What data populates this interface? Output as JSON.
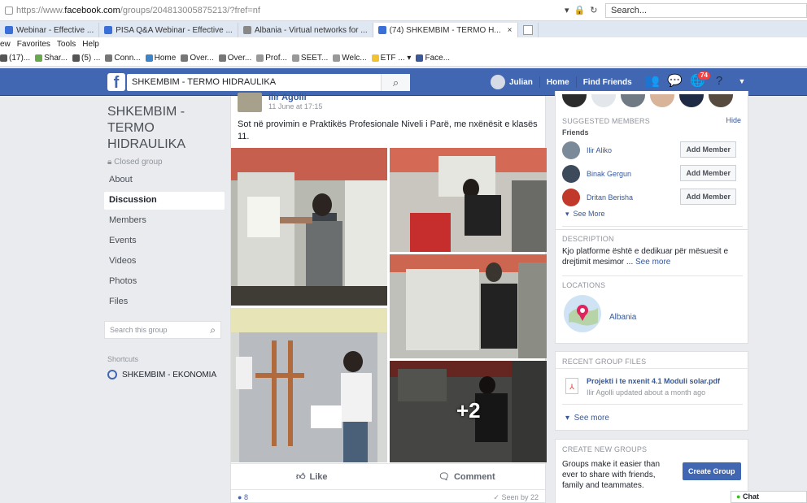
{
  "browser": {
    "url_prefix": "https://www.",
    "url_domain": "facebook.com",
    "url_path": "/groups/204813005875213/?fref=nf",
    "search_placeholder": "Search...",
    "tabs": [
      {
        "label": "Webinar - Effective ...",
        "color": "#3a6fd8"
      },
      {
        "label": "PISA Q&A Webinar - Effective ...",
        "color": "#3a6fd8"
      },
      {
        "label": "Albania - Virtual networks for ...",
        "color": "#888888"
      },
      {
        "label": "(74) SHKEMBIM - TERMO H...",
        "color": "#3a6fd8",
        "active": true
      }
    ],
    "menu": [
      "ew",
      "Favorites",
      "Tools",
      "Help"
    ],
    "favorites": [
      {
        "label": "(17)...",
        "color": "#555555"
      },
      {
        "label": "Shar...",
        "color": "#6aa84f"
      },
      {
        "label": "(5) ...",
        "color": "#555555"
      },
      {
        "label": "Conn...",
        "color": "#777777"
      },
      {
        "label": "Home",
        "color": "#3d85c6"
      },
      {
        "label": "Over...",
        "color": "#777777"
      },
      {
        "label": "Over...",
        "color": "#777777"
      },
      {
        "label": "Prof...",
        "color": "#999999"
      },
      {
        "label": "SEET...",
        "color": "#999999"
      },
      {
        "label": "Welc...",
        "color": "#999999"
      },
      {
        "label": "ETF ... ▾",
        "color": "#f1c232"
      },
      {
        "label": "Face...",
        "color": "#3b5998"
      }
    ]
  },
  "fb": {
    "logo": "f",
    "search_value": "SHKEMBIM - TERMO HIDRAULIKA",
    "user_name": "Julian",
    "home_label": "Home",
    "find_friends_label": "Find Friends",
    "notif_count": "74"
  },
  "left": {
    "group_name": "SHKEMBIM - TERMO HIDRAULIKA",
    "closed_label": "Closed group",
    "nav": [
      "About",
      "Discussion",
      "Members",
      "Events",
      "Videos",
      "Photos",
      "Files"
    ],
    "active_nav": "Discussion",
    "search_placeholder": "Search this group",
    "shortcuts_label": "Shortcuts",
    "shortcut_item": "SHKEMBIM - EKONOMIA"
  },
  "post": {
    "author": "Ilir Agolli",
    "time": "11 June at 17:15",
    "text": "Sot në provimin e Praktikës Profesionale Niveli i Parë, me nxënësit e klasës 11.",
    "more_photos": "+2",
    "like_label": "Like",
    "comment_label": "Comment",
    "reaction_count": "8",
    "seen_by": "✓ Seen by 22"
  },
  "right": {
    "suggested_title": "SUGGESTED MEMBERS",
    "hide_label": "Hide",
    "friends_label": "Friends",
    "members": [
      {
        "name": "Ilir Aliko",
        "button": "Add Member",
        "color": "#7a8a99"
      },
      {
        "name": "Binak Gergun",
        "button": "Add Member",
        "color": "#3d4a5c"
      },
      {
        "name": "Dritan Berisha",
        "button": "Add Member",
        "color": "#c0392b"
      }
    ],
    "see_more": "See More",
    "description_title": "DESCRIPTION",
    "description_text": "Kjo platforme është e dedikuar për mësuesit e drejtimit mesimor ...",
    "description_link": "See more",
    "locations_title": "LOCATIONS",
    "location_name": "Albania",
    "files_title": "RECENT GROUP FILES",
    "file_name": "Projekti i te nxenit 4.1 Moduli solar.pdf",
    "file_meta": "Ilir Agolli updated about a month ago",
    "files_see_more": "See more",
    "create_title": "CREATE NEW GROUPS",
    "create_text": "Groups make it easier than ever to share with friends, family and teammates.",
    "create_button": "Create Group"
  },
  "chat": {
    "label": "Chat"
  }
}
